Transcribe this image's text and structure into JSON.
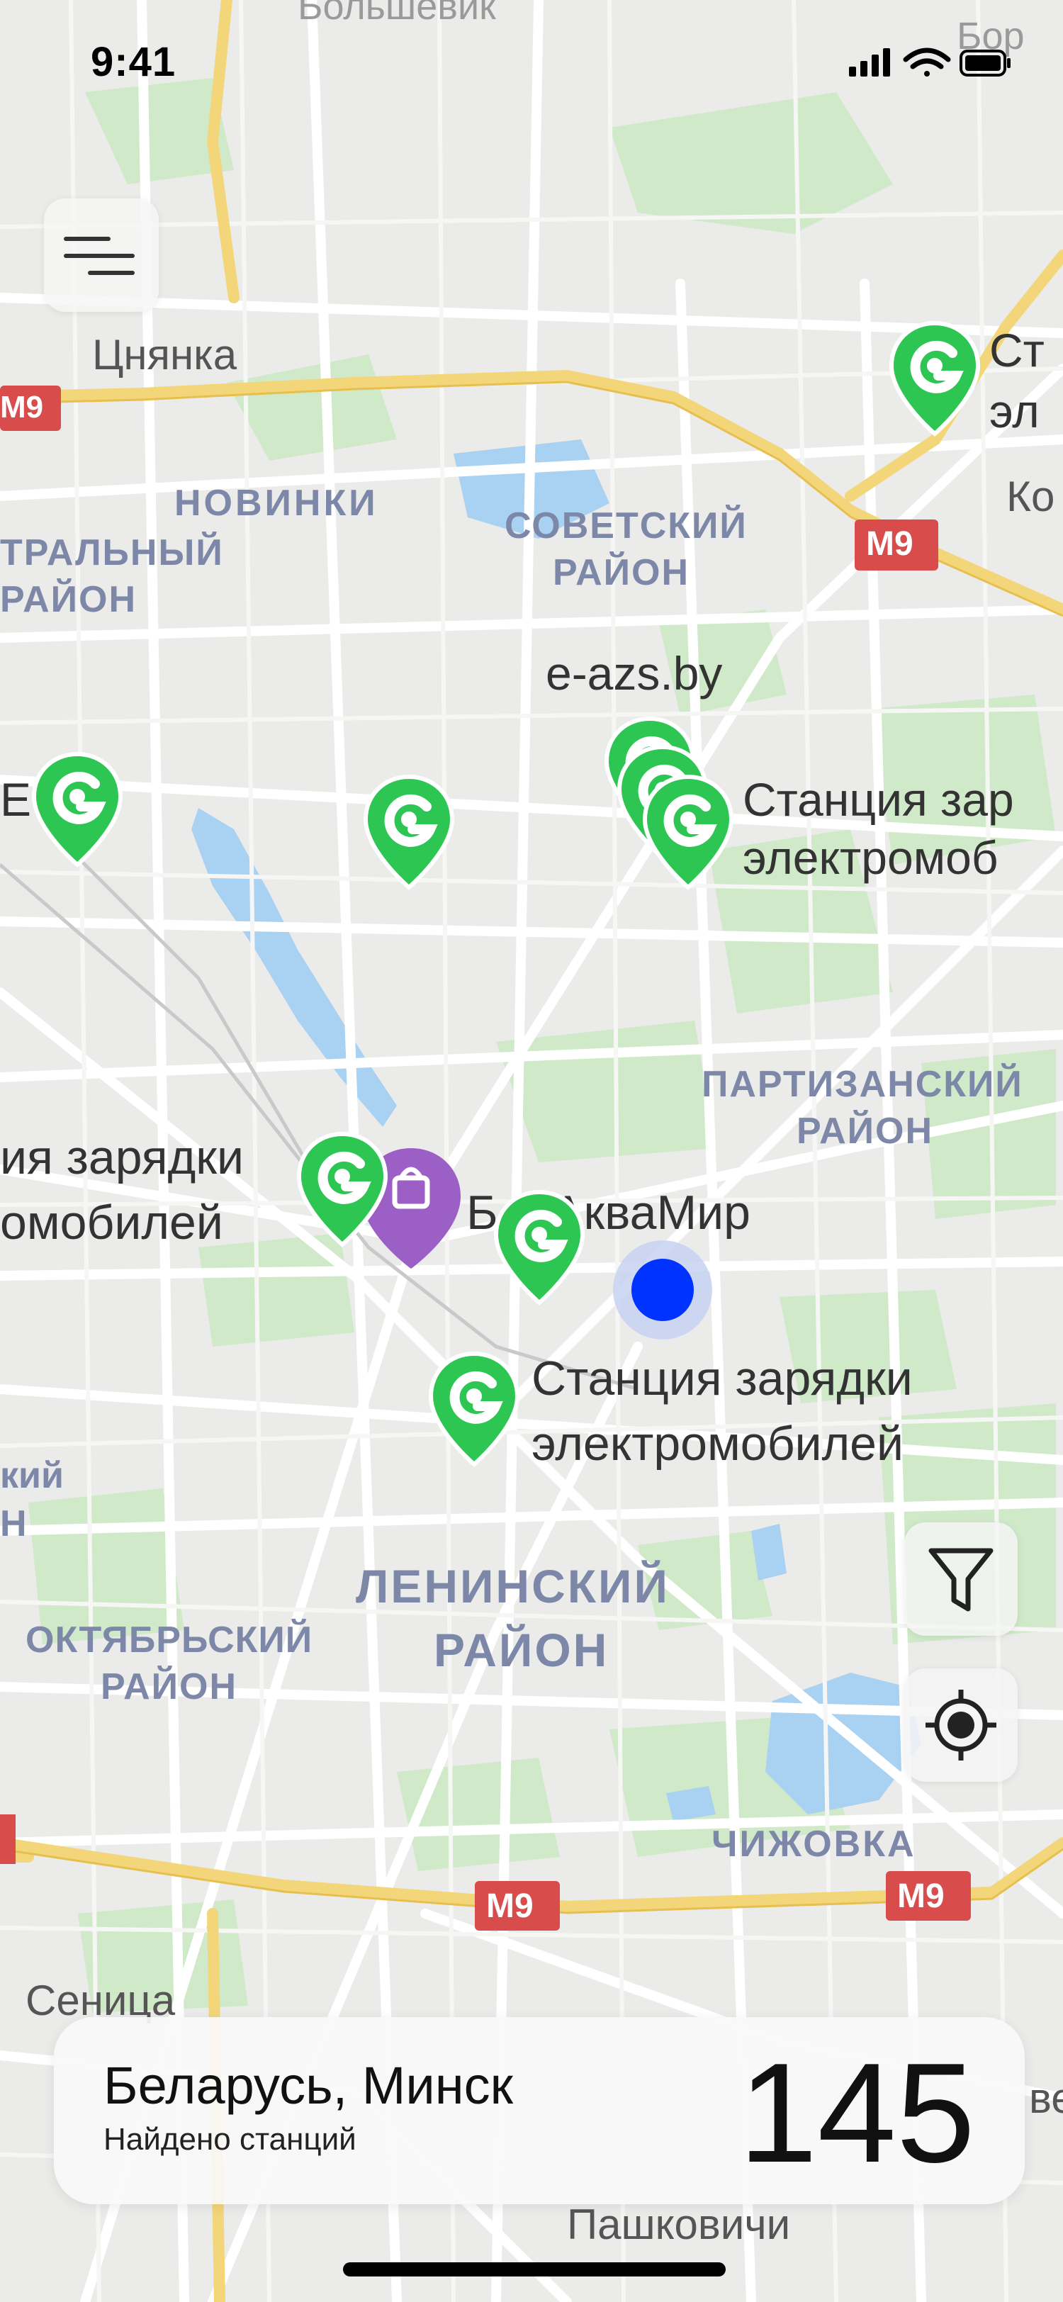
{
  "status_bar": {
    "time": "9:41"
  },
  "map": {
    "labels": {
      "bolshevik": "Большевик",
      "bor": "Бор",
      "tsnyanka": "Цнянка",
      "m9_1": "M9",
      "m9_2": "M9",
      "m9_3": "M9",
      "m9_4": "M9",
      "novinki": "НОВИНКИ",
      "tralny": "ТРАЛЬНЫЙ",
      "rayon1": "РАЙОН",
      "sovetsky": "СОВЕТСКИЙ",
      "rayon2": "РАЙОН",
      "kor": "Ко",
      "eazs": "e-azs.by",
      "st1_a": "Ст",
      "st1_b": "эл",
      "st2_a": "Станция зар",
      "st2_b": "электромоб",
      "e_left": "Е",
      "partizansky": "ПАРТИЗАНСКИЙ",
      "rayon3": "РАЙОН",
      "st3_a": "ия зарядки",
      "st3_b": "омобилей",
      "akvamir": "Б    АкваМир",
      "st4_a": "Станция зарядки",
      "st4_b": "электромобилей",
      "kiy": "кий",
      "n_left": "Н",
      "leninsky": "ЛЕНИНСКИЙ",
      "rayon4": "РАЙОН",
      "oktyabrsky": "ОКТЯБРЬСКИЙ",
      "rayon5": "РАЙОН",
      "chizhovka": "ЧИЖОВКА",
      "senitsa": "Сеница",
      "pashkovichi": "Пашковичи",
      "ve": "ве"
    }
  },
  "menu_button": {
    "icon": "menu-icon"
  },
  "filter_button": {
    "icon": "filter-icon"
  },
  "locate_button": {
    "icon": "locate-icon"
  },
  "bottom_card": {
    "city": "Беларусь, Минск",
    "found_label": "Найдено станций",
    "count": "145"
  },
  "colors": {
    "pin": "#2dc653",
    "user_location": "#0033ff",
    "accent_purple": "#9b5fc6"
  }
}
